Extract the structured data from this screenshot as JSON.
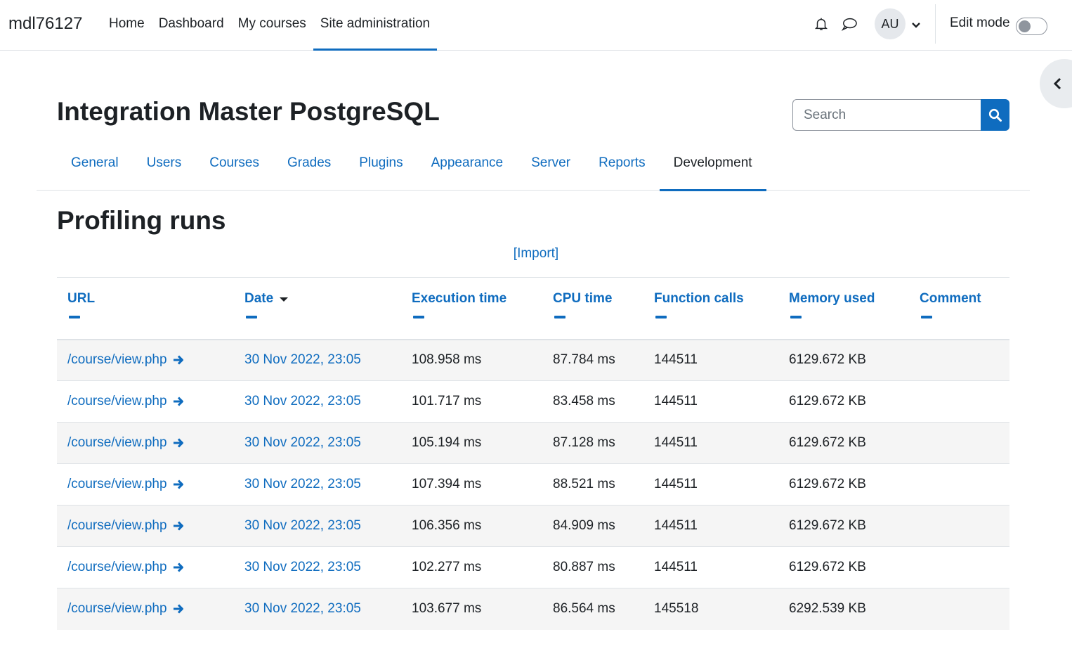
{
  "navbar": {
    "brand": "mdl76127",
    "items": [
      {
        "label": "Home"
      },
      {
        "label": "Dashboard"
      },
      {
        "label": "My courses"
      },
      {
        "label": "Site administration"
      }
    ],
    "active_item": "Site administration",
    "notification_icon": "bell-icon",
    "messages_icon": "chat-bubble-icon",
    "avatar_initials": "AU",
    "edit_mode_label": "Edit mode",
    "edit_mode_on": false
  },
  "header": {
    "title": "Integration Master PostgreSQL",
    "search_placeholder": "Search"
  },
  "secondary_nav": {
    "tabs": [
      {
        "label": "General"
      },
      {
        "label": "Users"
      },
      {
        "label": "Courses"
      },
      {
        "label": "Grades"
      },
      {
        "label": "Plugins"
      },
      {
        "label": "Appearance"
      },
      {
        "label": "Server"
      },
      {
        "label": "Reports"
      },
      {
        "label": "Development"
      }
    ],
    "active_tab": "Development"
  },
  "main": {
    "title": "Profiling runs",
    "import_link": "[Import]",
    "table": {
      "columns": [
        "URL",
        "Date",
        "Execution time",
        "CPU time",
        "Function calls",
        "Memory used",
        "Comment"
      ],
      "sorted_column": "Date",
      "rows": [
        {
          "url": "/course/view.php",
          "date": "30 Nov 2022, 23:05",
          "exec": "108.958 ms",
          "cpu": "87.784 ms",
          "calls": "144511",
          "memory": "6129.672 KB",
          "comment": ""
        },
        {
          "url": "/course/view.php",
          "date": "30 Nov 2022, 23:05",
          "exec": "101.717 ms",
          "cpu": "83.458 ms",
          "calls": "144511",
          "memory": "6129.672 KB",
          "comment": ""
        },
        {
          "url": "/course/view.php",
          "date": "30 Nov 2022, 23:05",
          "exec": "105.194 ms",
          "cpu": "87.128 ms",
          "calls": "144511",
          "memory": "6129.672 KB",
          "comment": ""
        },
        {
          "url": "/course/view.php",
          "date": "30 Nov 2022, 23:05",
          "exec": "107.394 ms",
          "cpu": "88.521 ms",
          "calls": "144511",
          "memory": "6129.672 KB",
          "comment": ""
        },
        {
          "url": "/course/view.php",
          "date": "30 Nov 2022, 23:05",
          "exec": "106.356 ms",
          "cpu": "84.909 ms",
          "calls": "144511",
          "memory": "6129.672 KB",
          "comment": ""
        },
        {
          "url": "/course/view.php",
          "date": "30 Nov 2022, 23:05",
          "exec": "102.277 ms",
          "cpu": "80.887 ms",
          "calls": "144511",
          "memory": "6129.672 KB",
          "comment": ""
        },
        {
          "url": "/course/view.php",
          "date": "30 Nov 2022, 23:05",
          "exec": "103.677 ms",
          "cpu": "86.564 ms",
          "calls": "145518",
          "memory": "6292.539 KB",
          "comment": ""
        }
      ]
    }
  },
  "colors": {
    "accent": "#0f6cbf",
    "text": "#1d2125",
    "border": "#dee2e6",
    "stripe": "#f5f5f5"
  }
}
